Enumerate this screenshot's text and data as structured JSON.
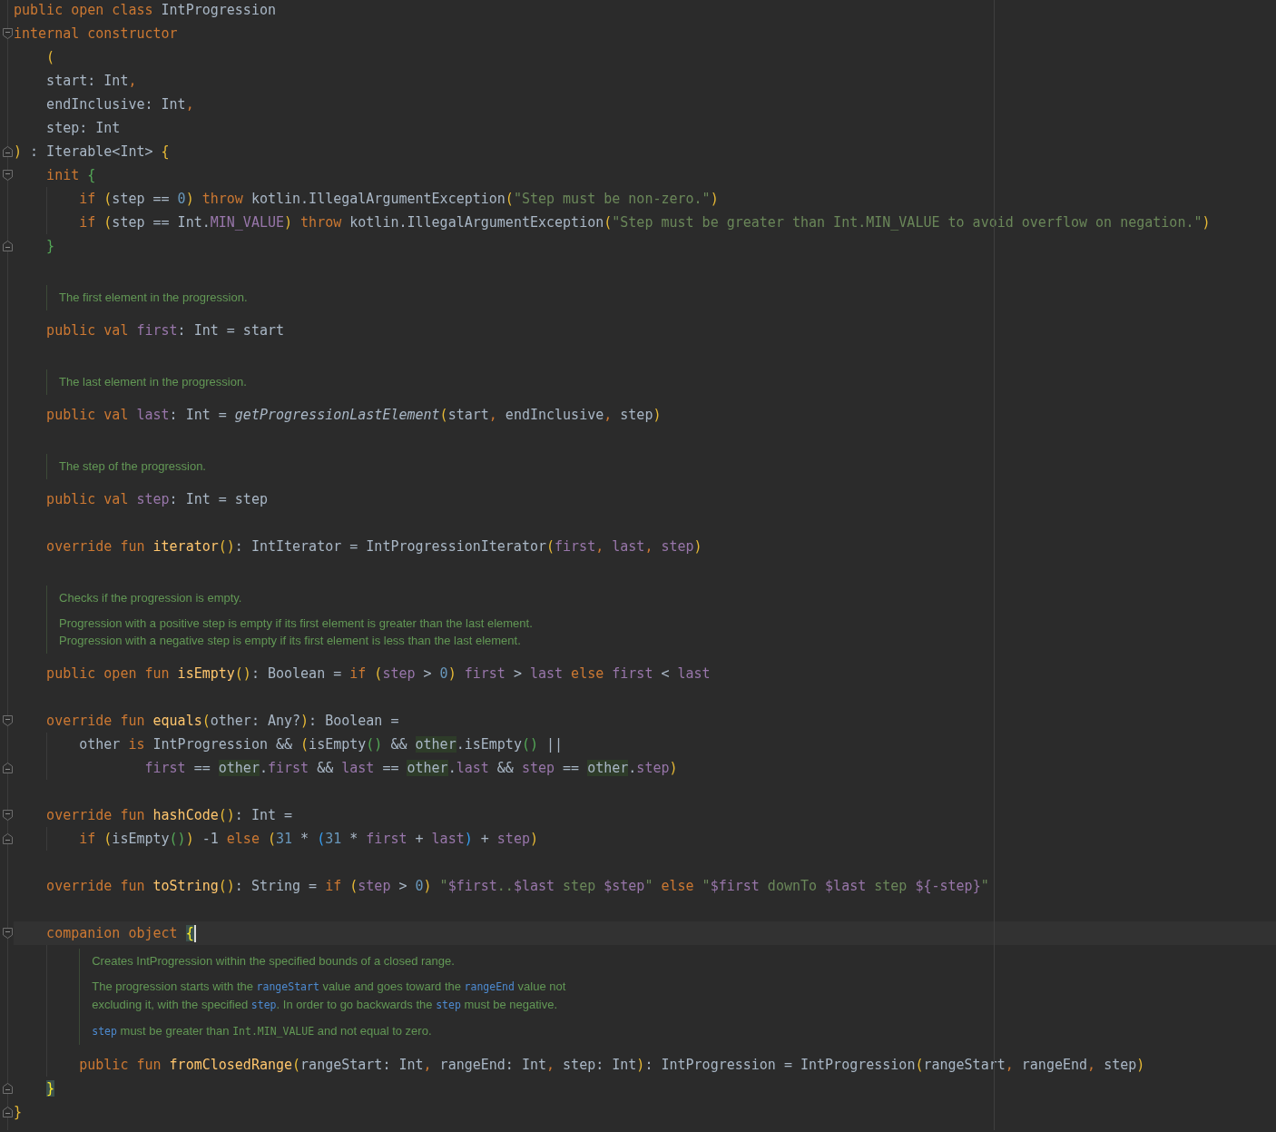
{
  "lines": [
    {
      "kind": "code",
      "current": false,
      "fold_start": false,
      "fold_end": false,
      "tokens": [
        {
          "kind": "kw",
          "text": "public open class "
        },
        {
          "kind": "pl",
          "text": "IntProgression"
        }
      ]
    },
    {
      "kind": "code",
      "current": false,
      "fold_start": true,
      "fold_end": false,
      "tokens": [
        {
          "kind": "kw",
          "text": "internal constructor"
        }
      ]
    },
    {
      "kind": "code",
      "current": false,
      "fold_start": false,
      "fold_end": false,
      "tokens": [
        {
          "kind": "p1",
          "text": "    ("
        }
      ]
    },
    {
      "kind": "code",
      "current": false,
      "fold_start": false,
      "fold_end": false,
      "tokens": [
        {
          "kind": "pl",
          "text": "    start: Int"
        },
        {
          "kind": "kw",
          "text": ","
        }
      ]
    },
    {
      "kind": "code",
      "current": false,
      "fold_start": false,
      "fold_end": false,
      "tokens": [
        {
          "kind": "pl",
          "text": "    endInclusive: Int"
        },
        {
          "kind": "kw",
          "text": ","
        }
      ]
    },
    {
      "kind": "code",
      "current": false,
      "fold_start": false,
      "fold_end": false,
      "tokens": [
        {
          "kind": "pl",
          "text": "    step: Int"
        }
      ]
    },
    {
      "kind": "code",
      "current": false,
      "fold_start": false,
      "fold_end": true,
      "tokens": [
        {
          "kind": "p1",
          "text": ")"
        },
        {
          "kind": "pl",
          "text": " : Iterable<Int> "
        },
        {
          "kind": "p1",
          "text": "{"
        }
      ]
    },
    {
      "kind": "code",
      "current": false,
      "fold_start": true,
      "fold_end": false,
      "tokens": [
        {
          "kind": "kw",
          "text": "    init "
        },
        {
          "kind": "p2",
          "text": "{"
        }
      ]
    },
    {
      "kind": "code",
      "current": false,
      "fold_start": false,
      "fold_end": false,
      "tokens": [
        {
          "kind": "kw",
          "text": "        if "
        },
        {
          "kind": "p1",
          "text": "("
        },
        {
          "kind": "pl",
          "text": "step == "
        },
        {
          "kind": "nu",
          "text": "0"
        },
        {
          "kind": "p1",
          "text": ")"
        },
        {
          "kind": "kw",
          "text": " throw "
        },
        {
          "kind": "pl",
          "text": "kotlin.IllegalArgumentException"
        },
        {
          "kind": "p1",
          "text": "("
        },
        {
          "kind": "st",
          "text": "\"Step must be non-zero.\""
        },
        {
          "kind": "p1",
          "text": ")"
        }
      ]
    },
    {
      "kind": "code",
      "current": false,
      "fold_start": false,
      "fold_end": false,
      "tokens": [
        {
          "kind": "kw",
          "text": "        if "
        },
        {
          "kind": "p1",
          "text": "("
        },
        {
          "kind": "pl",
          "text": "step == Int."
        },
        {
          "kind": "pr",
          "text": "MIN_VALUE"
        },
        {
          "kind": "p1",
          "text": ")"
        },
        {
          "kind": "kw",
          "text": " throw "
        },
        {
          "kind": "pl",
          "text": "kotlin.IllegalArgumentException"
        },
        {
          "kind": "p1",
          "text": "("
        },
        {
          "kind": "st",
          "text": "\"Step must be greater than Int.MIN_VALUE to avoid overflow on negation.\""
        },
        {
          "kind": "p1",
          "text": ")"
        }
      ]
    },
    {
      "kind": "code",
      "current": false,
      "fold_start": false,
      "fold_end": true,
      "tokens": [
        {
          "kind": "p2",
          "text": "    }"
        }
      ]
    },
    {
      "kind": "blank"
    },
    {
      "kind": "doc",
      "paragraphs": [
        [
          [
            {
              "kind": "text",
              "text": "The first element in the progression."
            }
          ]
        ]
      ]
    },
    {
      "kind": "code",
      "current": false,
      "fold_start": false,
      "fold_end": false,
      "tokens": [
        {
          "kind": "kw",
          "text": "    public val "
        },
        {
          "kind": "pr",
          "text": "first"
        },
        {
          "kind": "pl",
          "text": ": Int = start"
        }
      ]
    },
    {
      "kind": "blank"
    },
    {
      "kind": "doc",
      "paragraphs": [
        [
          [
            {
              "kind": "text",
              "text": "The last element in the progression."
            }
          ]
        ]
      ]
    },
    {
      "kind": "code",
      "current": false,
      "fold_start": false,
      "fold_end": false,
      "tokens": [
        {
          "kind": "kw",
          "text": "    public val "
        },
        {
          "kind": "pr",
          "text": "last"
        },
        {
          "kind": "pl",
          "text": ": Int = "
        },
        {
          "kind": "it",
          "text": "getProgressionLastElement"
        },
        {
          "kind": "p1",
          "text": "("
        },
        {
          "kind": "pl",
          "text": "start"
        },
        {
          "kind": "kw",
          "text": ", "
        },
        {
          "kind": "pl",
          "text": "endInclusive"
        },
        {
          "kind": "kw",
          "text": ", "
        },
        {
          "kind": "pl",
          "text": "step"
        },
        {
          "kind": "p1",
          "text": ")"
        }
      ]
    },
    {
      "kind": "blank"
    },
    {
      "kind": "doc",
      "paragraphs": [
        [
          [
            {
              "kind": "text",
              "text": "The step of the progression."
            }
          ]
        ]
      ]
    },
    {
      "kind": "code",
      "current": false,
      "fold_start": false,
      "fold_end": false,
      "tokens": [
        {
          "kind": "kw",
          "text": "    public val "
        },
        {
          "kind": "pr",
          "text": "step"
        },
        {
          "kind": "pl",
          "text": ": Int = step"
        }
      ]
    },
    {
      "kind": "blank"
    },
    {
      "kind": "code",
      "current": false,
      "fold_start": false,
      "fold_end": false,
      "tokens": [
        {
          "kind": "kw",
          "text": "    override fun "
        },
        {
          "kind": "fn",
          "text": "iterator"
        },
        {
          "kind": "p1",
          "text": "()"
        },
        {
          "kind": "pl",
          "text": ": IntIterator = IntProgressionIterator"
        },
        {
          "kind": "p1",
          "text": "("
        },
        {
          "kind": "pr",
          "text": "first"
        },
        {
          "kind": "kw",
          "text": ", "
        },
        {
          "kind": "pr",
          "text": "last"
        },
        {
          "kind": "kw",
          "text": ", "
        },
        {
          "kind": "pr",
          "text": "step"
        },
        {
          "kind": "p1",
          "text": ")"
        }
      ]
    },
    {
      "kind": "blank"
    },
    {
      "kind": "doc",
      "paragraphs": [
        [
          [
            {
              "kind": "text",
              "text": "Checks if the progression is empty."
            }
          ]
        ],
        [
          [
            {
              "kind": "text",
              "text": "Progression with a positive step is empty if its first element is greater than the last element."
            }
          ],
          [
            {
              "kind": "text",
              "text": "Progression with a negative step is empty if its first element is less than the last element."
            }
          ]
        ]
      ]
    },
    {
      "kind": "code",
      "current": false,
      "fold_start": false,
      "fold_end": false,
      "tokens": [
        {
          "kind": "kw",
          "text": "    public open fun "
        },
        {
          "kind": "fn",
          "text": "isEmpty"
        },
        {
          "kind": "p1",
          "text": "()"
        },
        {
          "kind": "pl",
          "text": ": Boolean = "
        },
        {
          "kind": "kw",
          "text": "if "
        },
        {
          "kind": "p1",
          "text": "("
        },
        {
          "kind": "pr",
          "text": "step"
        },
        {
          "kind": "pl",
          "text": " > "
        },
        {
          "kind": "nu",
          "text": "0"
        },
        {
          "kind": "p1",
          "text": ")"
        },
        {
          "kind": "pr",
          "text": " first"
        },
        {
          "kind": "pl",
          "text": " > "
        },
        {
          "kind": "pr",
          "text": "last"
        },
        {
          "kind": "kw",
          "text": " else "
        },
        {
          "kind": "pr",
          "text": "first"
        },
        {
          "kind": "pl",
          "text": " < "
        },
        {
          "kind": "pr",
          "text": "last"
        }
      ]
    },
    {
      "kind": "blank"
    },
    {
      "kind": "code",
      "current": false,
      "fold_start": true,
      "fold_end": false,
      "tokens": [
        {
          "kind": "kw",
          "text": "    override fun "
        },
        {
          "kind": "fn",
          "text": "equals"
        },
        {
          "kind": "p1",
          "text": "("
        },
        {
          "kind": "pl",
          "text": "other: Any?"
        },
        {
          "kind": "p1",
          "text": ")"
        },
        {
          "kind": "pl",
          "text": ": Boolean ="
        }
      ]
    },
    {
      "kind": "code",
      "current": false,
      "fold_start": false,
      "fold_end": false,
      "tokens": [
        {
          "kind": "pl",
          "text": "        other "
        },
        {
          "kind": "kw",
          "text": "is "
        },
        {
          "kind": "pl",
          "text": "IntProgression && "
        },
        {
          "kind": "p1",
          "text": "("
        },
        {
          "kind": "pl",
          "text": "isEmpty"
        },
        {
          "kind": "p2",
          "text": "()"
        },
        {
          "kind": "pl",
          "text": " && "
        },
        {
          "kind": "us",
          "text": "other"
        },
        {
          "kind": "pl",
          "text": ".isEmpty"
        },
        {
          "kind": "p2",
          "text": "()"
        },
        {
          "kind": "pl",
          "text": " ||"
        }
      ]
    },
    {
      "kind": "code",
      "current": false,
      "fold_start": false,
      "fold_end": true,
      "tokens": [
        {
          "kind": "pr",
          "text": "                first"
        },
        {
          "kind": "pl",
          "text": " == "
        },
        {
          "kind": "us",
          "text": "other"
        },
        {
          "kind": "pl",
          "text": "."
        },
        {
          "kind": "pr",
          "text": "first"
        },
        {
          "kind": "pl",
          "text": " && "
        },
        {
          "kind": "pr",
          "text": "last"
        },
        {
          "kind": "pl",
          "text": " == "
        },
        {
          "kind": "us",
          "text": "other"
        },
        {
          "kind": "pl",
          "text": "."
        },
        {
          "kind": "pr",
          "text": "last"
        },
        {
          "kind": "pl",
          "text": " && "
        },
        {
          "kind": "pr",
          "text": "step"
        },
        {
          "kind": "pl",
          "text": " == "
        },
        {
          "kind": "us",
          "text": "other"
        },
        {
          "kind": "pl",
          "text": "."
        },
        {
          "kind": "pr",
          "text": "step"
        },
        {
          "kind": "p1",
          "text": ")"
        }
      ]
    },
    {
      "kind": "blank"
    },
    {
      "kind": "code",
      "current": false,
      "fold_start": true,
      "fold_end": false,
      "tokens": [
        {
          "kind": "kw",
          "text": "    override fun "
        },
        {
          "kind": "fn",
          "text": "hashCode"
        },
        {
          "kind": "p1",
          "text": "()"
        },
        {
          "kind": "pl",
          "text": ": Int ="
        }
      ]
    },
    {
      "kind": "code",
      "current": false,
      "fold_start": false,
      "fold_end": true,
      "tokens": [
        {
          "kind": "kw",
          "text": "        if "
        },
        {
          "kind": "p1",
          "text": "("
        },
        {
          "kind": "pl",
          "text": "isEmpty"
        },
        {
          "kind": "p2",
          "text": "()"
        },
        {
          "kind": "p1",
          "text": ")"
        },
        {
          "kind": "pl",
          "text": " -1 "
        },
        {
          "kind": "kw",
          "text": "else "
        },
        {
          "kind": "p1",
          "text": "("
        },
        {
          "kind": "nu",
          "text": "31"
        },
        {
          "kind": "pl",
          "text": " * "
        },
        {
          "kind": "p3",
          "text": "("
        },
        {
          "kind": "nu",
          "text": "31"
        },
        {
          "kind": "pl",
          "text": " * "
        },
        {
          "kind": "pr",
          "text": "first"
        },
        {
          "kind": "pl",
          "text": " + "
        },
        {
          "kind": "pr",
          "text": "last"
        },
        {
          "kind": "p3",
          "text": ")"
        },
        {
          "kind": "pl",
          "text": " + "
        },
        {
          "kind": "pr",
          "text": "step"
        },
        {
          "kind": "p1",
          "text": ")"
        }
      ]
    },
    {
      "kind": "blank"
    },
    {
      "kind": "code",
      "current": false,
      "fold_start": false,
      "fold_end": false,
      "tokens": [
        {
          "kind": "kw",
          "text": "    override fun "
        },
        {
          "kind": "fn",
          "text": "toString"
        },
        {
          "kind": "p1",
          "text": "()"
        },
        {
          "kind": "pl",
          "text": ": String = "
        },
        {
          "kind": "kw",
          "text": "if "
        },
        {
          "kind": "p1",
          "text": "("
        },
        {
          "kind": "pr",
          "text": "step"
        },
        {
          "kind": "pl",
          "text": " > "
        },
        {
          "kind": "nu",
          "text": "0"
        },
        {
          "kind": "p1",
          "text": ")"
        },
        {
          "kind": "st",
          "text": " \""
        },
        {
          "kind": "pr",
          "text": "$first"
        },
        {
          "kind": "st",
          "text": ".."
        },
        {
          "kind": "pr",
          "text": "$last"
        },
        {
          "kind": "st",
          "text": " step "
        },
        {
          "kind": "pr",
          "text": "$step"
        },
        {
          "kind": "st",
          "text": "\""
        },
        {
          "kind": "kw",
          "text": " else "
        },
        {
          "kind": "st",
          "text": "\""
        },
        {
          "kind": "pr",
          "text": "$first"
        },
        {
          "kind": "st",
          "text": " downTo "
        },
        {
          "kind": "pr",
          "text": "$last"
        },
        {
          "kind": "st",
          "text": " step "
        },
        {
          "kind": "pr",
          "text": "${-step}"
        },
        {
          "kind": "st",
          "text": "\""
        }
      ]
    },
    {
      "kind": "blank"
    },
    {
      "kind": "code",
      "current": true,
      "fold_start": true,
      "fold_end": false,
      "tokens": [
        {
          "kind": "kw",
          "text": "    companion object "
        },
        {
          "kind": "bm",
          "text": "{"
        }
      ]
    },
    {
      "kind": "doc",
      "paragraphs": [
        [
          [
            {
              "kind": "text",
              "text": "Creates IntProgression within the specified bounds of a closed range."
            }
          ]
        ],
        [
          [
            {
              "kind": "text",
              "text": "The progression starts with the "
            },
            {
              "kind": "ref",
              "text": "rangeStart"
            },
            {
              "kind": "text",
              "text": " value and goes toward the "
            },
            {
              "kind": "ref",
              "text": "rangeEnd"
            },
            {
              "kind": "text",
              "text": " value not"
            }
          ],
          [
            {
              "kind": "text",
              "text": "excluding it, with the specified "
            },
            {
              "kind": "ref",
              "text": "step"
            },
            {
              "kind": "text",
              "text": ". In order to go backwards the "
            },
            {
              "kind": "ref",
              "text": "step"
            },
            {
              "kind": "text",
              "text": " must be negative."
            }
          ]
        ],
        [
          [
            {
              "kind": "ref",
              "text": "step"
            },
            {
              "kind": "text",
              "text": " must be greater than "
            },
            {
              "kind": "mono",
              "text": "Int.MIN_VALUE"
            },
            {
              "kind": "text",
              "text": " and not equal to zero."
            }
          ]
        ]
      ]
    },
    {
      "kind": "code",
      "current": false,
      "fold_start": false,
      "fold_end": false,
      "tokens": [
        {
          "kind": "kw",
          "text": "        public fun "
        },
        {
          "kind": "fn",
          "text": "fromClosedRange"
        },
        {
          "kind": "p1",
          "text": "("
        },
        {
          "kind": "pl",
          "text": "rangeStart: Int"
        },
        {
          "kind": "kw",
          "text": ", "
        },
        {
          "kind": "pl",
          "text": "rangeEnd: Int"
        },
        {
          "kind": "kw",
          "text": ", "
        },
        {
          "kind": "pl",
          "text": "step: Int"
        },
        {
          "kind": "p1",
          "text": ")"
        },
        {
          "kind": "pl",
          "text": ": IntProgression = IntProgression"
        },
        {
          "kind": "p1",
          "text": "("
        },
        {
          "kind": "pl",
          "text": "rangeStart"
        },
        {
          "kind": "kw",
          "text": ", "
        },
        {
          "kind": "pl",
          "text": "rangeEnd"
        },
        {
          "kind": "kw",
          "text": ", "
        },
        {
          "kind": "pl",
          "text": "step"
        },
        {
          "kind": "p1",
          "text": ")"
        }
      ]
    },
    {
      "kind": "code",
      "current": false,
      "fold_start": false,
      "fold_end": true,
      "tokens": [
        {
          "kind": "bm",
          "text": "    }"
        }
      ]
    },
    {
      "kind": "code",
      "current": false,
      "fold_start": false,
      "fold_end": true,
      "tokens": [
        {
          "kind": "p1",
          "text": "}"
        }
      ]
    }
  ]
}
